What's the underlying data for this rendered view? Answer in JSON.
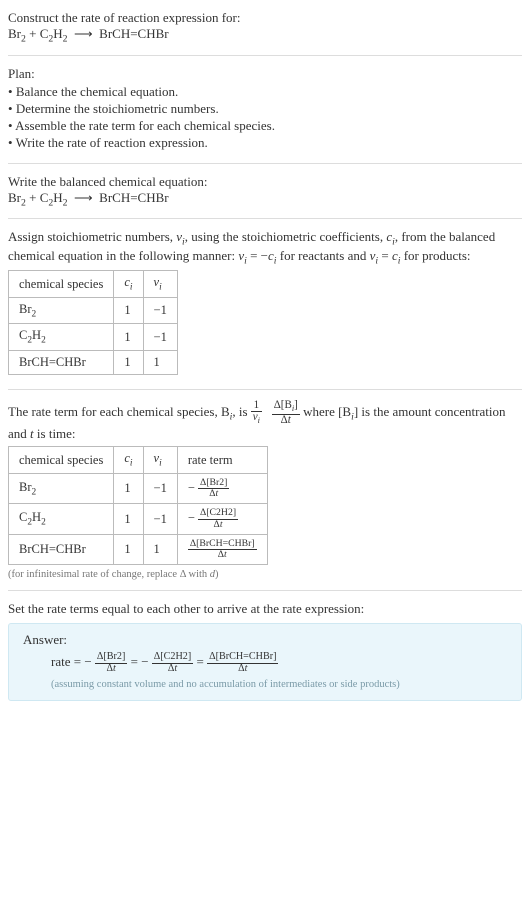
{
  "header": {
    "title": "Construct the rate of reaction expression for:",
    "equation_html": "Br<sub>2</sub> + C<sub>2</sub>H<sub>2</sub> &nbsp;⟶&nbsp; BrCH=CHBr"
  },
  "plan": {
    "title": "Plan:",
    "items": [
      "Balance the chemical equation.",
      "Determine the stoichiometric numbers.",
      "Assemble the rate term for each chemical species.",
      "Write the rate of reaction expression."
    ]
  },
  "balanced": {
    "title": "Write the balanced chemical equation:",
    "equation_html": "Br<sub>2</sub> + C<sub>2</sub>H<sub>2</sub> &nbsp;⟶&nbsp; BrCH=CHBr"
  },
  "stoich": {
    "intro_html": "Assign stoichiometric numbers, <span class='ital'>ν</span><span class='subi'>i</span>, using the stoichiometric coefficients, <span class='ital'>c</span><span class='subi'>i</span>, from the balanced chemical equation in the following manner: <span class='ital'>ν</span><span class='subi'>i</span> = −<span class='ital'>c</span><span class='subi'>i</span> for reactants and <span class='ital'>ν</span><span class='subi'>i</span> = <span class='ital'>c</span><span class='subi'>i</span> for products:",
    "headers": {
      "species": "chemical species",
      "ci_html": "<span class='ital'>c</span><span class='subi'>i</span>",
      "vi_html": "<span class='ital'>ν</span><span class='subi'>i</span>"
    },
    "rows": [
      {
        "species_html": "Br<sub>2</sub>",
        "ci": "1",
        "vi": "−1"
      },
      {
        "species_html": "C<sub>2</sub>H<sub>2</sub>",
        "ci": "1",
        "vi": "−1"
      },
      {
        "species_html": "BrCH=CHBr",
        "ci": "1",
        "vi": "1"
      }
    ]
  },
  "rateterm": {
    "intro_pre_html": "The rate term for each chemical species, B<span class='subi'>i</span>, is ",
    "frac1_num_html": "1",
    "frac1_den_html": "<span class='ital'>ν</span><span class='subi'>i</span>",
    "frac2_num_html": "Δ[B<span class='subi'>i</span>]",
    "frac2_den_html": "Δ<span class='ital'>t</span>",
    "intro_post_html": " where [B<span class='subi'>i</span>] is the amount concentration and <span class='ital'>t</span> is time:",
    "headers": {
      "species": "chemical species",
      "ci_html": "<span class='ital'>c</span><span class='subi'>i</span>",
      "vi_html": "<span class='ital'>ν</span><span class='subi'>i</span>",
      "rate": "rate term"
    },
    "rows": [
      {
        "species_html": "Br<sub>2</sub>",
        "ci": "1",
        "vi": "−1",
        "sign": "−",
        "num_html": "Δ[Br2]",
        "den_html": "Δ<span class='ital'>t</span>"
      },
      {
        "species_html": "C<sub>2</sub>H<sub>2</sub>",
        "ci": "1",
        "vi": "−1",
        "sign": "−",
        "num_html": "Δ[C2H2]",
        "den_html": "Δ<span class='ital'>t</span>"
      },
      {
        "species_html": "BrCH=CHBr",
        "ci": "1",
        "vi": "1",
        "sign": "",
        "num_html": "Δ[BrCH=CHBr]",
        "den_html": "Δ<span class='ital'>t</span>"
      }
    ],
    "note_html": "(for infinitesimal rate of change, replace Δ with <span class='ital'>d</span>)"
  },
  "final": {
    "intro": "Set the rate terms equal to each other to arrive at the rate expression:",
    "answer_label": "Answer:",
    "rate_prefix": "rate = ",
    "terms": [
      {
        "sign": "−",
        "num_html": "Δ[Br2]",
        "den_html": "Δ<span class='ital'>t</span>"
      },
      {
        "sign": "−",
        "num_html": "Δ[C2H2]",
        "den_html": "Δ<span class='ital'>t</span>"
      },
      {
        "sign": "",
        "num_html": "Δ[BrCH=CHBr]",
        "den_html": "Δ<span class='ital'>t</span>"
      }
    ],
    "eq": " = ",
    "note": "(assuming constant volume and no accumulation of intermediates or side products)"
  }
}
